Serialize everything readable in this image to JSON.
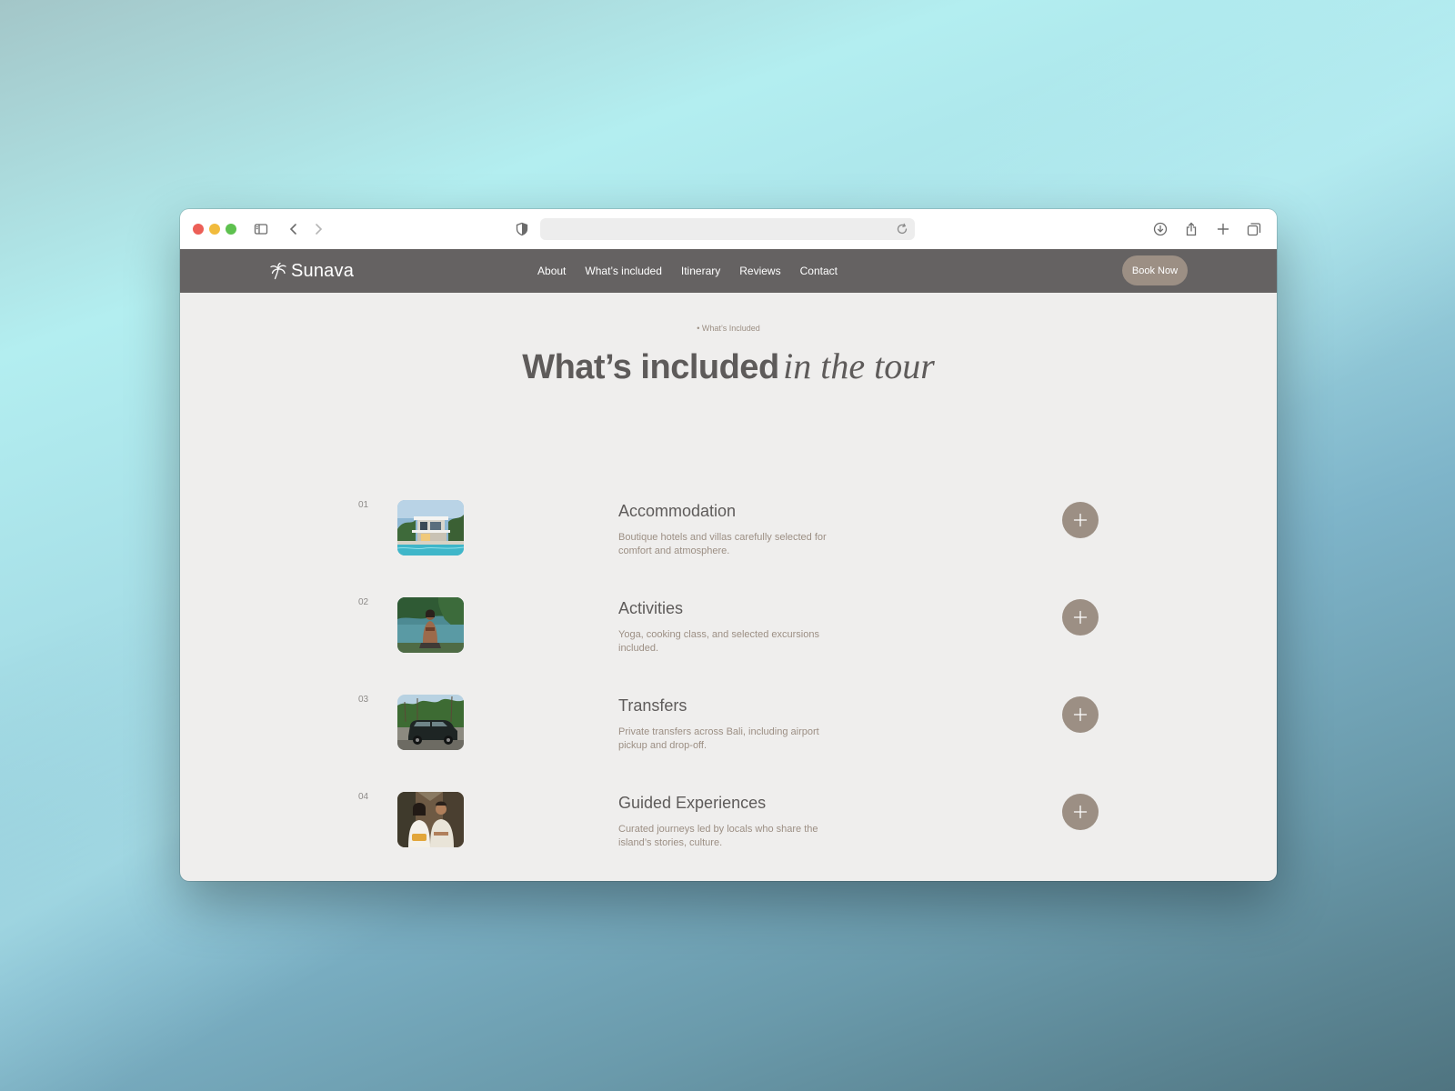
{
  "brand": {
    "name": "Sunava"
  },
  "nav": {
    "links": [
      "About",
      "What’s included",
      "Itinerary",
      "Reviews",
      "Contact"
    ],
    "cta": "Book Now"
  },
  "section": {
    "eyebrow": "• What’s Included",
    "heading_plain": "What’s included",
    "heading_italic": "in the tour"
  },
  "items": [
    {
      "number": "01",
      "title": "Accommodation",
      "description": "Boutique hotels and villas carefully selected for comfort and atmosphere."
    },
    {
      "number": "02",
      "title": "Activities",
      "description": "Yoga, cooking class, and selected excursions included."
    },
    {
      "number": "03",
      "title": "Transfers",
      "description": "Private transfers across Bali, including airport pickup and drop-off."
    },
    {
      "number": "04",
      "title": "Guided Experiences",
      "description": "Curated journeys led by locals who share the island’s stories, culture."
    }
  ],
  "colors": {
    "nav_bg": "#656262",
    "accent": "#9c8f84",
    "page_bg": "#efeeed",
    "heading": "#5e5b5a"
  },
  "icons": {
    "logo": "palm-tree-icon",
    "expand": "plus-icon"
  }
}
